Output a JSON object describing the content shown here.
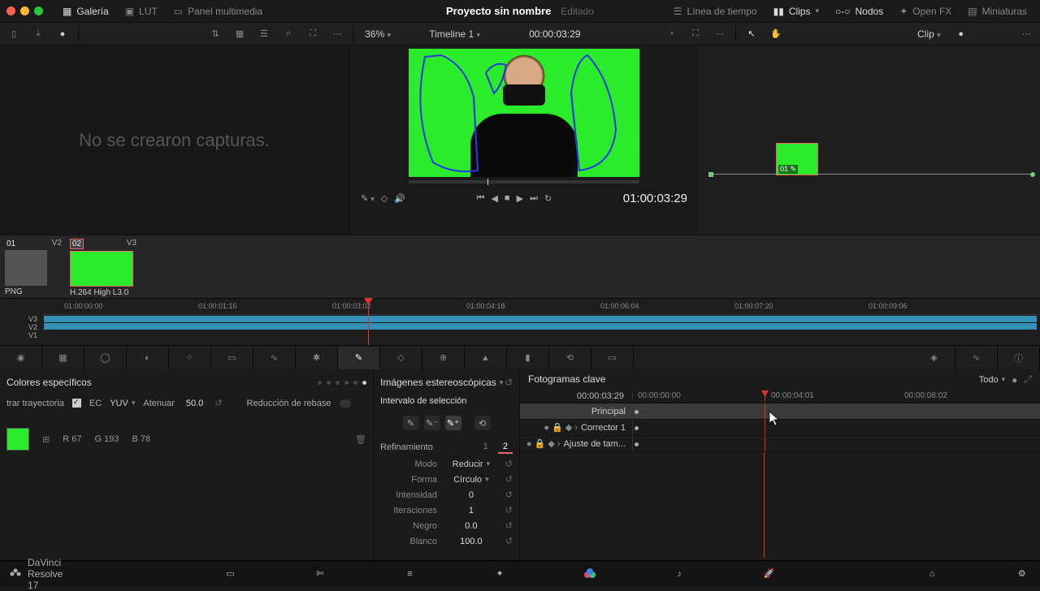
{
  "topbar": {
    "gallery": "Galería",
    "lut": "LUT",
    "media": "Panel multimedia",
    "project": "Proyecto sin nombre",
    "edited": "Editado",
    "timeline": "Línea de tiempo",
    "clips": "Clips",
    "nodes": "Nodos",
    "openfx": "Open FX",
    "thumbs": "Miniaturas"
  },
  "toolbar2": {
    "zoom": "36%",
    "timeline_name": "Timeline 1",
    "timecode": "00:00:03:29",
    "clip_mode": "Clip"
  },
  "gallery": {
    "empty": "No se crearon capturas."
  },
  "viewer": {
    "tc": "01:00:03:29"
  },
  "clips": {
    "items": [
      {
        "num": "01",
        "track": "V2",
        "format": "PNG"
      },
      {
        "num": "02",
        "track": "V3",
        "format": "H.264 High L3.0"
      }
    ]
  },
  "timeline": {
    "tracks": [
      "V3",
      "V2",
      "V1"
    ],
    "ticks": [
      "01:00:00:00",
      "01:00:01:16",
      "01:00:03:02",
      "01:00:04:18",
      "01:00:06:04",
      "01:00:07:20",
      "01:00:09:06"
    ]
  },
  "qualifier": {
    "title": "Colores específicos",
    "trajectory": "trar trayectoria",
    "ec": "EC",
    "colorspace": "YUV",
    "attenuate": "Atenuar",
    "attenuate_val": "50.0",
    "reduction": "Reducción de rebase",
    "rgb": {
      "r": "R 67",
      "g": "G 193",
      "b": "B 78"
    }
  },
  "stereo": {
    "title": "Imágenes estereoscópicas",
    "selection_title": "Intervalo de selección",
    "refinement": "Refinamiento",
    "tabs": [
      "1",
      "2"
    ],
    "mode_label": "Modo",
    "mode_val": "Reducir",
    "shape_label": "Forma",
    "shape_val": "Círculo",
    "intensity_label": "Intensidad",
    "intensity_val": "0",
    "iterations_label": "Iteraciones",
    "iterations_val": "1",
    "black_label": "Negro",
    "black_val": "0.0",
    "white_label": "Blanco",
    "white_val": "100.0"
  },
  "keyframes": {
    "title": "Fotogramas clave",
    "filter": "Todo",
    "current_tc": "00:00:03:29",
    "ticks": [
      "00:00:00:00",
      "00:00:04:01",
      "00:00:08:02"
    ],
    "rows": [
      {
        "label": "Principal",
        "active": true
      },
      {
        "label": "Corrector 1",
        "active": false
      },
      {
        "label": "Ajuste de tam...",
        "active": false
      }
    ]
  },
  "node": {
    "label": "01"
  },
  "footer": {
    "app": "DaVinci Resolve 17"
  }
}
